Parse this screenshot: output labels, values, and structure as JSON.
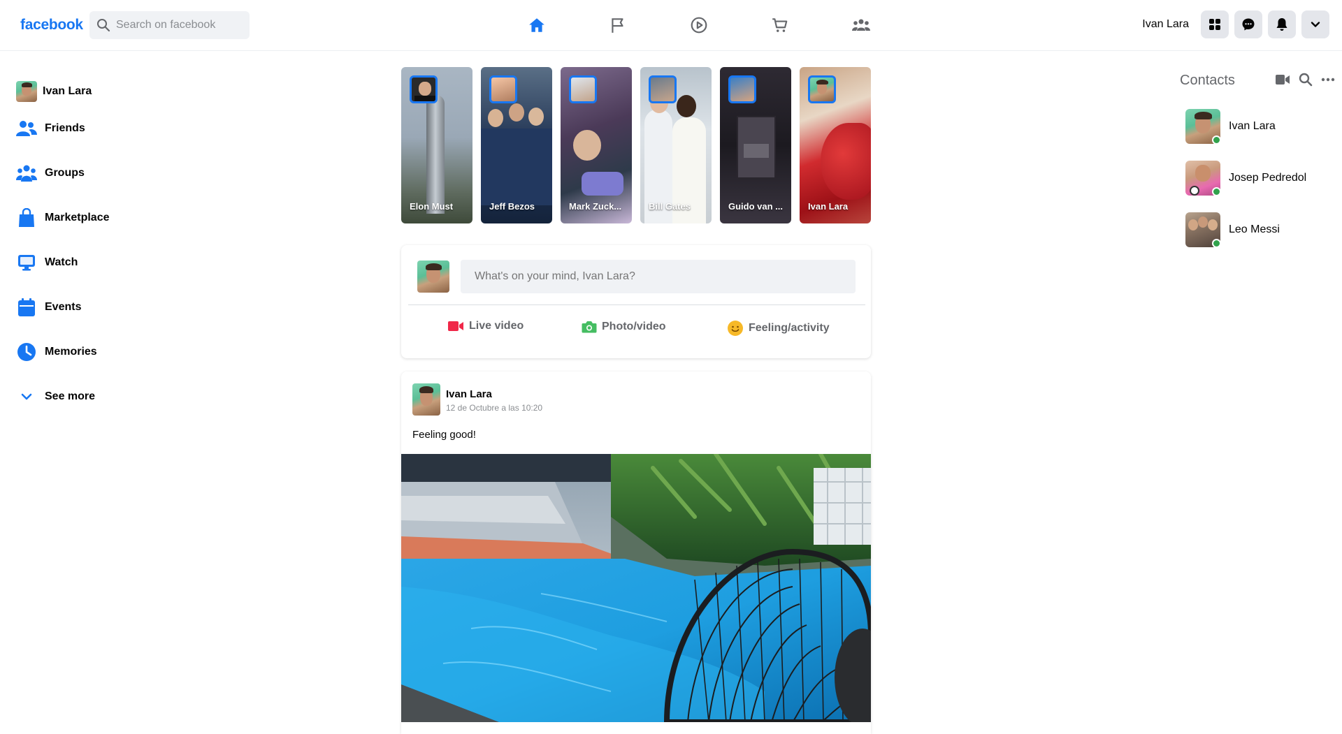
{
  "header": {
    "logo": "facebook",
    "search_placeholder": "Search on facebook",
    "nav_icons": [
      "home-icon",
      "flag-icon",
      "watch-icon",
      "marketplace-icon",
      "groups-icon"
    ],
    "user_name": "Ivan Lara",
    "right_icons": [
      "menu-grid-icon",
      "messenger-icon",
      "bell-icon",
      "chevron-down-icon"
    ],
    "accent": "#1877f2"
  },
  "sidebar": {
    "items": [
      {
        "label": "Ivan Lara",
        "icon": "avatar"
      },
      {
        "label": "Friends",
        "icon": "friends-icon"
      },
      {
        "label": "Groups",
        "icon": "groups-icon"
      },
      {
        "label": "Marketplace",
        "icon": "marketplace-bag-icon"
      },
      {
        "label": "Watch",
        "icon": "watch-monitor-icon"
      },
      {
        "label": "Events",
        "icon": "calendar-icon"
      },
      {
        "label": "Memories",
        "icon": "clock-icon"
      },
      {
        "label": "See more",
        "icon": "chevron-down-icon"
      }
    ]
  },
  "stories": [
    {
      "name": "Elon Must"
    },
    {
      "name": "Jeff Bezos"
    },
    {
      "name": "Mark Zuck..."
    },
    {
      "name": "Bill Gates"
    },
    {
      "name": "Guido van ..."
    },
    {
      "name": "Ivan Lara"
    }
  ],
  "composer": {
    "placeholder": "What's on your mind, Ivan Lara?",
    "actions": [
      {
        "label": "Live video",
        "color": "#f02849"
      },
      {
        "label": "Photo/video",
        "color": "#45bd62"
      },
      {
        "label": "Feeling/activity",
        "color": "#f7b928"
      }
    ]
  },
  "post": {
    "author": "Ivan Lara",
    "date": "12 de Octubre a las 10:20",
    "text": "Feeling good!"
  },
  "contacts": {
    "title": "Contacts",
    "icons": [
      "video-camera-icon",
      "search-icon",
      "more-dots-icon"
    ],
    "list": [
      {
        "name": "Ivan Lara",
        "online": true
      },
      {
        "name": "Josep Pedredol",
        "online": true
      },
      {
        "name": "Leo Messi",
        "online": true
      }
    ]
  }
}
